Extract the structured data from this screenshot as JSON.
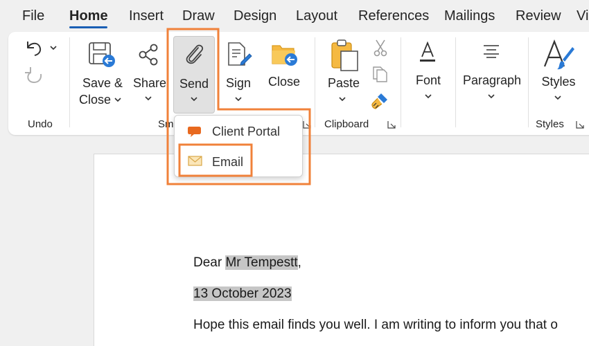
{
  "tabs": [
    {
      "label": "File"
    },
    {
      "label": "Home"
    },
    {
      "label": "Insert"
    },
    {
      "label": "Draw"
    },
    {
      "label": "Design"
    },
    {
      "label": "Layout"
    },
    {
      "label": "References"
    },
    {
      "label": "Mailings"
    },
    {
      "label": "Review"
    },
    {
      "label": "Vi"
    }
  ],
  "ribbon": {
    "undo_group": "Undo",
    "save_close": [
      "Save &",
      "Close"
    ],
    "share": "Share",
    "send": "Send",
    "sign": "Sign",
    "close": "Close",
    "send_group_partial": "Sm",
    "paste": "Paste",
    "clipboard_group": "Clipboard",
    "font": "Font",
    "paragraph": "Paragraph",
    "styles": "Styles",
    "styles_group": "Styles"
  },
  "send_menu": {
    "items": [
      {
        "label": "Client Portal",
        "icon": "chat-bubble-icon"
      },
      {
        "label": "Email",
        "icon": "envelope-icon"
      }
    ]
  },
  "document": {
    "salutation_prefix": "Dear ",
    "recipient": "Mr Tempestt",
    "salutation_suffix": ",",
    "date": "13 October 2023",
    "body_line": "Hope this email finds you well. I am writing to inform you that o"
  },
  "colors": {
    "accent_blue": "#1a5fb4",
    "highlight_orange": "#f0813a",
    "text_highlight": "#c6c6c6"
  }
}
